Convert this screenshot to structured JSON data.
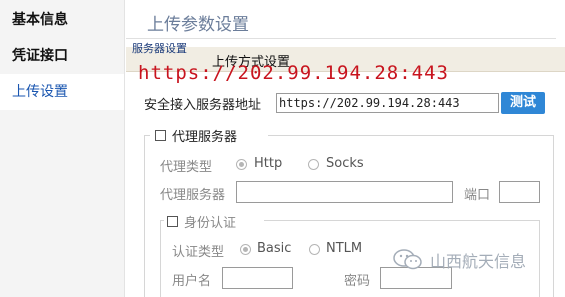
{
  "sidebar": {
    "items": [
      {
        "label": "基本信息",
        "active": false
      },
      {
        "label": "凭证接口",
        "active": false
      },
      {
        "label": "上传设置",
        "active": true
      }
    ]
  },
  "header": {
    "title": "上传参数设置"
  },
  "tabs": {
    "server": "服务器设置",
    "upload": "上传方式设置"
  },
  "overlay": {
    "url": "https://202.99.194.28:443"
  },
  "server": {
    "address_label": "安全接入服务器地址",
    "address_value": "https://202.99.194.28:443",
    "test_button": "测试"
  },
  "proxy": {
    "group_label": "代理服务器",
    "type_label": "代理类型",
    "type_options": [
      "Http",
      "Socks"
    ],
    "selected_type": "Http",
    "server_label": "代理服务器",
    "server_value": "",
    "port_label": "端口",
    "port_value": ""
  },
  "auth": {
    "group_label": "身份认证",
    "type_label": "认证类型",
    "type_options": [
      "Basic",
      "NTLM"
    ],
    "selected_type": "Basic",
    "username_label": "用户名",
    "password_label": "密码"
  },
  "watermark": {
    "text": "山西航天信息"
  },
  "colors": {
    "accent": "#2f87d6",
    "nav_active": "#1a56b0",
    "overlay_red": "#c8141e"
  }
}
